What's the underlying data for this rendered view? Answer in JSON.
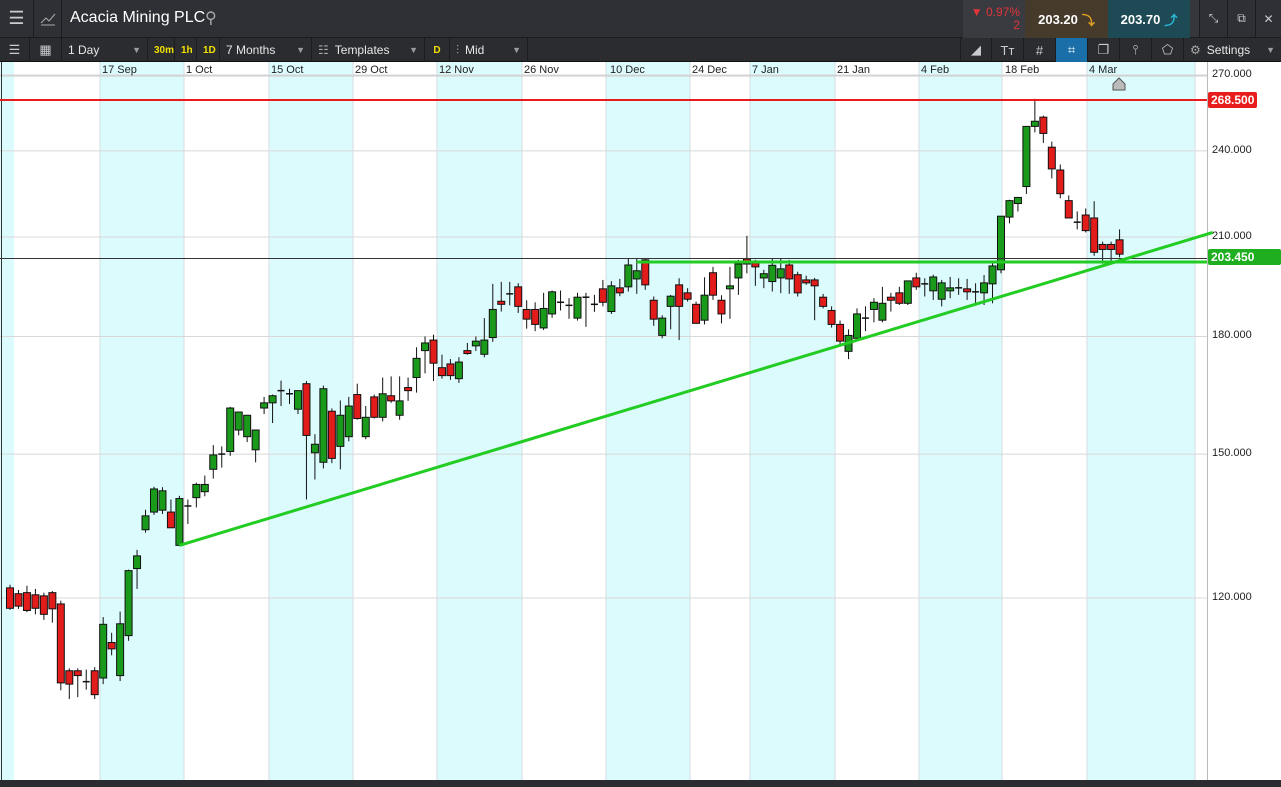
{
  "header": {
    "title": "Acacia Mining PLC",
    "change_pct": "▼ 0.97%",
    "change_abs": "2",
    "sell_price": "203.20",
    "buy_price": "203.70"
  },
  "toolbar": {
    "interval": "1 Day",
    "quick": [
      "30m",
      "1h",
      "1D"
    ],
    "range": "7 Months",
    "templates": "Templates",
    "d": "D",
    "price_type": "Mid",
    "settings": "Settings"
  },
  "axis": {
    "x_labels": [
      "17 Sep",
      "1 Oct",
      "15 Oct",
      "29 Oct",
      "12 Nov",
      "26 Nov",
      "10 Dec",
      "24 Dec",
      "7 Jan",
      "21 Jan",
      "4 Feb",
      "18 Feb",
      "4 Mar"
    ],
    "y_labels": [
      "270.000",
      "240.000",
      "210.000",
      "180.000",
      "150.000",
      "120.000"
    ]
  },
  "levels": {
    "resistance": "268.500",
    "current": "203.450"
  },
  "colors": {
    "up": "#1a9a1a",
    "down": "#e21b1b",
    "trend": "#22cc22",
    "resistance": "#e81c1c",
    "band": "#dcfbfd"
  },
  "chart_data": {
    "type": "candlestick",
    "scale": "log",
    "ylim": [
      100,
      275
    ],
    "y_ticks": [
      270,
      240,
      210,
      180,
      150,
      120
    ],
    "candles_ohlc": [
      [
        121.9,
        122.5,
        117.8,
        118.1
      ],
      [
        120.8,
        121.5,
        118,
        118.5
      ],
      [
        121.0,
        122.3,
        117.4,
        117.7
      ],
      [
        120.6,
        121.7,
        117.0,
        118.1
      ],
      [
        120.4,
        121.0,
        116.0,
        117.0
      ],
      [
        121.0,
        121.3,
        115.5,
        118.0
      ],
      [
        118.9,
        119.5,
        104,
        105.2
      ],
      [
        107.2,
        107.6,
        102.6,
        105.0
      ],
      [
        107.2,
        107.6,
        102.9,
        106.4
      ],
      [
        105.4,
        107.4,
        104.1,
        105.3
      ],
      [
        107.2,
        107.8,
        102.6,
        103.3
      ],
      [
        106,
        116.5,
        105,
        115.2
      ],
      [
        112,
        113.7,
        109.8,
        110.9
      ],
      [
        106.4,
        117.5,
        105.5,
        115.3
      ],
      [
        113.2,
        125.4,
        112.3,
        125.2
      ],
      [
        125.6,
        129.3,
        121.7,
        128.1
      ],
      [
        133.4,
        137.6,
        132.8,
        136.3
      ],
      [
        137.1,
        142.6,
        136.5,
        142.1
      ],
      [
        137.5,
        142.5,
        136.7,
        141.7
      ],
      [
        137.1,
        139.8,
        133.8,
        133.8
      ],
      [
        130.2,
        140.6,
        130.2,
        140.0
      ],
      [
        138.4,
        139.8,
        134.6,
        138.4
      ],
      [
        140.2,
        143.5,
        138.1,
        143.1
      ],
      [
        141.5,
        145.1,
        140.5,
        143.1
      ],
      [
        146.5,
        152.1,
        144.4,
        149.8
      ],
      [
        150,
        151.8,
        146.9,
        150
      ],
      [
        150.6,
        161.4,
        149.6,
        161.1
      ],
      [
        155.7,
        160.1,
        154.4,
        160.1
      ],
      [
        154.1,
        159.3,
        152.8,
        159.3
      ],
      [
        151.0,
        155.7,
        148.1,
        155.7
      ],
      [
        161.1,
        163.9,
        159.6,
        162.4
      ],
      [
        162.4,
        164.5,
        157.4,
        164.2
      ],
      [
        165.5,
        168.1,
        161.6,
        165.5
      ],
      [
        164.7,
        166,
        162.1,
        164.7
      ],
      [
        160.8,
        165.5,
        159.6,
        165.5
      ],
      [
        167.3,
        168,
        139.8,
        154.4
      ],
      [
        150.3,
        154.7,
        144.2,
        152.3
      ],
      [
        148.1,
        166.8,
        146.7,
        166.0
      ],
      [
        160.3,
        161,
        147.9,
        149.0
      ],
      [
        151.8,
        163,
        146.5,
        159.3
      ],
      [
        154.1,
        163.9,
        153,
        161.6
      ],
      [
        164.5,
        167.3,
        158.2,
        158.5
      ],
      [
        154.1,
        161.6,
        153.5,
        158.8
      ],
      [
        163.9,
        164.5,
        158.5,
        158.8
      ],
      [
        158.8,
        168.9,
        157.8,
        164.7
      ],
      [
        164.2,
        169.2,
        162.4,
        162.9
      ],
      [
        159.3,
        169.2,
        158.2,
        162.9
      ],
      [
        166.3,
        168.9,
        162.9,
        165.5
      ],
      [
        168.9,
        177,
        165,
        174.0
      ],
      [
        176.1,
        180,
        170,
        178.2
      ],
      [
        179.0,
        180.5,
        168,
        172.7
      ],
      [
        171.5,
        175,
        168.6,
        169.4
      ],
      [
        172.5,
        173.8,
        168.3,
        169.4
      ],
      [
        168.6,
        174.3,
        167.5,
        173.0
      ],
      [
        176.1,
        178.2,
        175,
        175.3
      ],
      [
        177.4,
        180,
        176,
        178.7
      ],
      [
        175.1,
        185.2,
        174.3,
        179.0
      ],
      [
        179.7,
        195.3,
        178.5,
        187.7
      ],
      [
        190.1,
        195.9,
        187.1,
        189.2
      ],
      [
        192.3,
        195.9,
        188.9,
        192.3
      ],
      [
        194.4,
        195.5,
        186.7,
        188.6
      ],
      [
        187.7,
        190.4,
        182.2,
        184.9
      ],
      [
        187.7,
        189.8,
        181.5,
        183.4
      ],
      [
        182.4,
        192.6,
        181.8,
        188.0
      ],
      [
        186.4,
        193.3,
        185.3,
        192.9
      ],
      [
        189.8,
        193.3,
        187.4,
        189.8
      ],
      [
        188.9,
        191,
        185,
        188.9
      ],
      [
        185.2,
        192.6,
        184.5,
        191.3
      ],
      [
        191.3,
        192.6,
        182.7,
        191.3
      ],
      [
        189.2,
        192,
        187,
        189.2
      ],
      [
        193.8,
        196.5,
        188.6,
        189.8
      ],
      [
        187.1,
        196.1,
        186.4,
        194.7
      ],
      [
        194.1,
        196.8,
        191.6,
        192.6
      ],
      [
        194.4,
        203,
        193,
        201.1
      ],
      [
        196.8,
        203.3,
        192.3,
        199.3
      ],
      [
        202.7,
        203.3,
        193.5,
        195.0
      ],
      [
        190.4,
        191.5,
        183,
        184.9
      ],
      [
        180.3,
        186,
        179.5,
        185.2
      ],
      [
        188.6,
        192,
        182,
        191.6
      ],
      [
        195.0,
        197,
        179,
        188.6
      ],
      [
        192.6,
        194,
        190,
        190.7
      ],
      [
        189.2,
        190,
        184,
        183.7
      ],
      [
        184.6,
        197.3,
        183.4,
        191.9
      ],
      [
        198.7,
        200.5,
        190.5,
        191.9
      ],
      [
        190.4,
        191.9,
        183.7,
        186.4
      ],
      [
        193.8,
        200.5,
        185,
        194.7
      ],
      [
        197.1,
        202.7,
        192,
        201.4
      ],
      [
        203,
        210.4,
        198.5,
        201.4
      ],
      [
        201.7,
        202.7,
        194.7,
        200.5
      ],
      [
        197.1,
        199.6,
        194,
        198.4
      ],
      [
        196,
        203,
        193,
        201
      ],
      [
        197.1,
        203,
        192.5,
        199.9
      ],
      [
        201.1,
        202.7,
        192.3,
        196.8
      ],
      [
        198.1,
        199,
        191.5,
        192.6
      ],
      [
        196.5,
        197.8,
        195,
        195.6
      ],
      [
        196.5,
        197.1,
        184.6,
        194.7
      ],
      [
        191.3,
        192.3,
        188,
        188.6
      ],
      [
        187.4,
        188.6,
        182.5,
        183.4
      ],
      [
        183.4,
        184.5,
        177.5,
        178.7
      ],
      [
        175.9,
        182,
        173.8,
        180.3
      ],
      [
        179.5,
        188,
        178.7,
        186.4
      ],
      [
        185.2,
        188.6,
        181.5,
        185.2
      ],
      [
        187.7,
        191,
        184,
        189.8
      ],
      [
        184.6,
        194.4,
        184,
        189.5
      ],
      [
        191.3,
        192.6,
        187.1,
        190.4
      ],
      [
        192.6,
        194.4,
        189,
        189.5
      ],
      [
        189.5,
        196.2,
        189,
        196.2
      ],
      [
        197.1,
        198.7,
        193.5,
        194.4
      ],
      [
        195.3,
        197,
        191.5,
        195.3
      ],
      [
        193.2,
        198.1,
        190.5,
        197.4
      ],
      [
        190.7,
        196.5,
        188.6,
        195.6
      ],
      [
        193.2,
        197.4,
        191,
        194.1
      ],
      [
        194.1,
        197,
        192,
        194.1
      ],
      [
        193.8,
        196.8,
        190.5,
        192.9
      ],
      [
        192.9,
        195.5,
        189,
        192.9
      ],
      [
        192.6,
        198,
        189,
        195.6
      ],
      [
        195.3,
        201.7,
        189.5,
        200.8
      ],
      [
        199.6,
        216.9,
        198.5,
        216.9
      ],
      [
        216.6,
        222.5,
        214.5,
        222.2
      ],
      [
        221.2,
        223.5,
        218.5,
        223.3
      ],
      [
        227.1,
        249.3,
        224.5,
        249.3
      ],
      [
        249.3,
        260.2,
        247,
        251.3
      ],
      [
        252.9,
        253.5,
        243,
        246.6
      ],
      [
        241.4,
        243.5,
        230,
        233.4
      ],
      [
        233.0,
        235,
        223,
        224.6
      ],
      [
        222.2,
        224,
        217,
        216.3
      ],
      [
        214.9,
        218.5,
        212.5,
        214.9
      ],
      [
        217.3,
        219.5,
        211.5,
        212.1
      ],
      [
        216.3,
        222,
        204,
        205.1
      ],
      [
        207.6,
        208.5,
        201.5,
        206.0
      ],
      [
        207.6,
        208.5,
        202.5,
        206.0
      ],
      [
        209.1,
        212.5,
        203.5,
        204.5
      ]
    ],
    "horizontal_lines": [
      {
        "name": "resistance",
        "price": 268.5
      },
      {
        "name": "current",
        "price": 203.45
      },
      {
        "name": "support",
        "price": 202.6,
        "from_candle": 74
      }
    ],
    "trendline": {
      "from_candle": 20,
      "from_price": 130.2,
      "to_candle": 142,
      "to_price": 211.5
    }
  }
}
